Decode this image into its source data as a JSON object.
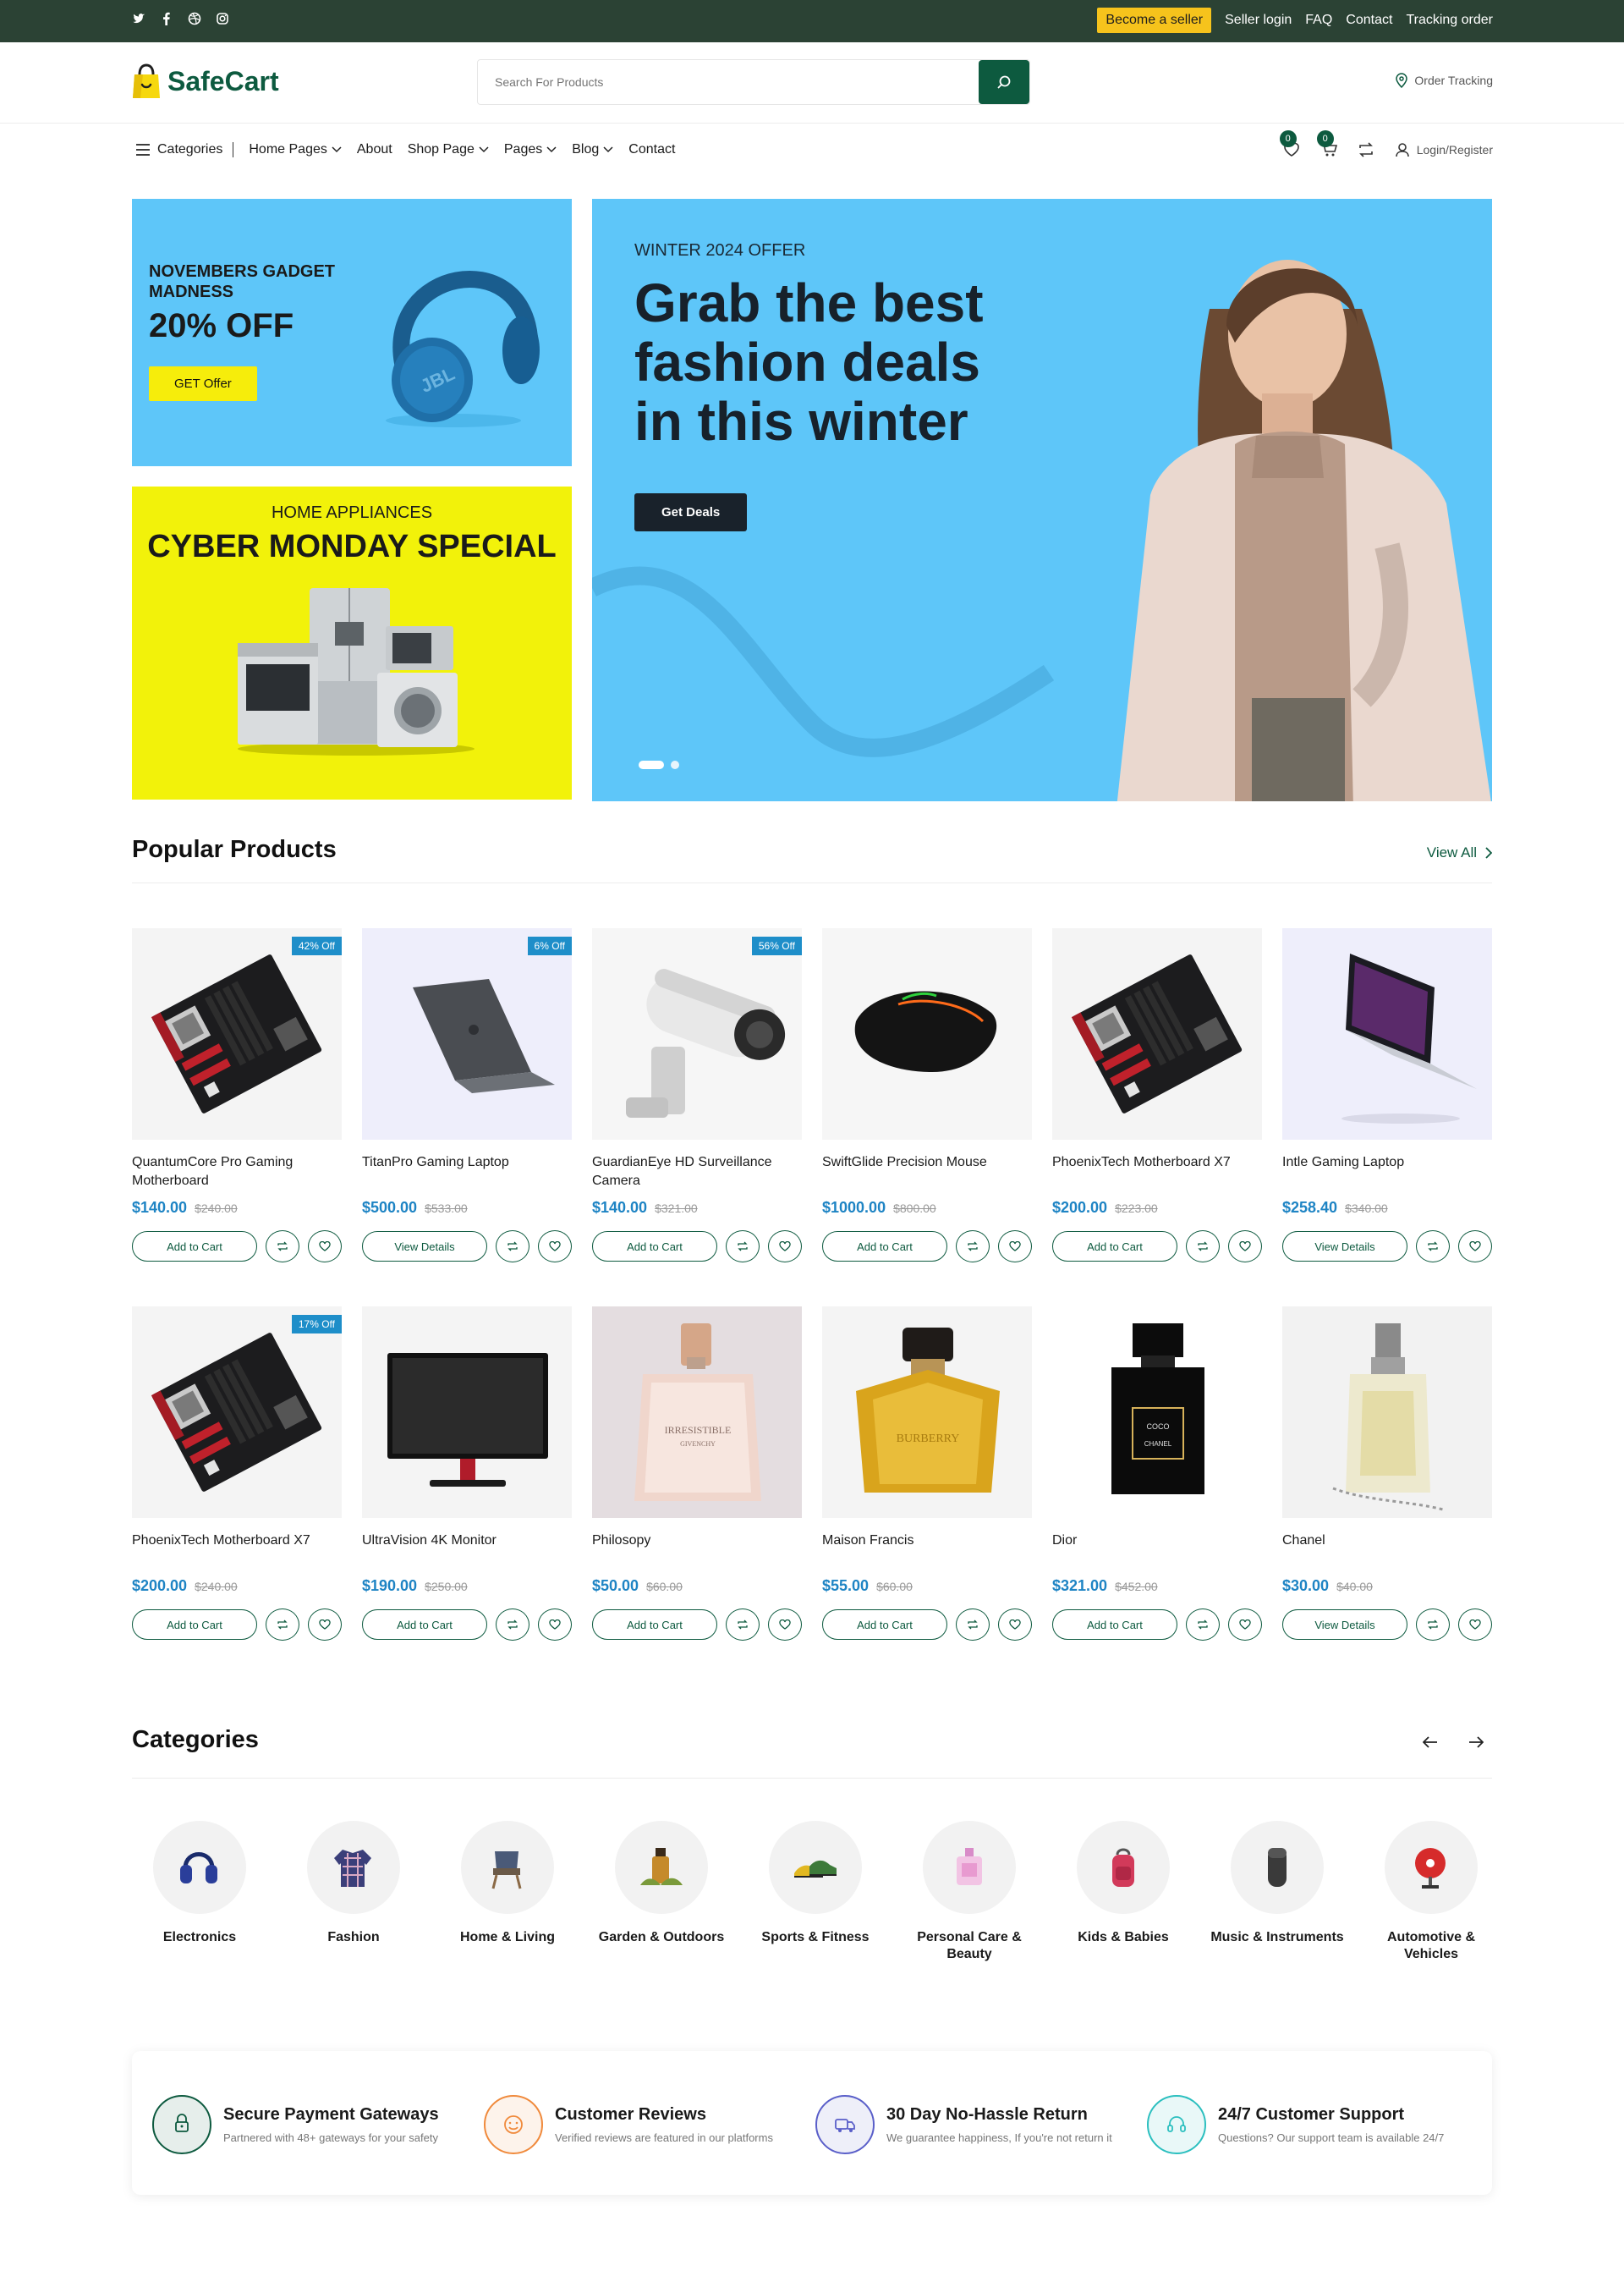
{
  "topbar": {
    "social_icons": [
      "twitter-icon",
      "facebook-icon",
      "dribbble-icon",
      "instagram-icon"
    ],
    "become_seller": "Become a seller",
    "links": [
      "Seller login",
      "FAQ",
      "Contact",
      "Tracking order"
    ]
  },
  "header": {
    "logo_text": "SafeCart",
    "search_placeholder": "Search For Products",
    "order_tracking": "Order Tracking"
  },
  "nav": {
    "categories": "Categories",
    "items": [
      "Home Pages",
      "About",
      "Shop Page",
      "Pages",
      "Blog",
      "Contact"
    ],
    "wishlist_count": "0",
    "cart_count": "0",
    "login": "Login/Register"
  },
  "banners": {
    "gadget": {
      "eyebrow": "NOVEMBERS GADGET MADNESS",
      "headline": "20% OFF",
      "button": "GET Offer"
    },
    "appliances": {
      "eyebrow": "HOME APPLIANCES",
      "headline": "CYBER MONDAY SPECIAL"
    },
    "hero": {
      "eyebrow": "WINTER 2024 OFFER",
      "headline_lines": [
        "Grab the best",
        "fashion deals",
        "in this winter"
      ],
      "button": "Get Deals"
    }
  },
  "popular": {
    "title": "Popular Products",
    "view_all": "View All",
    "products": [
      {
        "name": "QuantumCore Pro Gaming Motherboard",
        "price": "$140.00",
        "old": "$240.00",
        "badge": "42% Off",
        "button": "Add to Cart",
        "img": "motherboard"
      },
      {
        "name": "TitanPro Gaming Laptop",
        "price": "$500.00",
        "old": "$533.00",
        "badge": "6% Off",
        "button": "View Details",
        "img": "laptop-grey"
      },
      {
        "name": "GuardianEye HD Surveillance Camera",
        "price": "$140.00",
        "old": "$321.00",
        "badge": "56% Off",
        "button": "Add to Cart",
        "img": "camera"
      },
      {
        "name": "SwiftGlide Precision Mouse",
        "price": "$1000.00",
        "old": "$800.00",
        "badge": "",
        "button": "Add to Cart",
        "img": "mouse"
      },
      {
        "name": "PhoenixTech Motherboard X7",
        "price": "$200.00",
        "old": "$223.00",
        "badge": "",
        "button": "Add to Cart",
        "img": "motherboard"
      },
      {
        "name": "Intle Gaming Laptop",
        "price": "$258.40",
        "old": "$340.00",
        "badge": "",
        "button": "View Details",
        "img": "laptop-open"
      },
      {
        "name": "PhoenixTech Motherboard X7",
        "price": "$200.00",
        "old": "$240.00",
        "badge": "17% Off",
        "button": "Add to Cart",
        "img": "motherboard"
      },
      {
        "name": "UltraVision 4K Monitor",
        "price": "$190.00",
        "old": "$250.00",
        "badge": "",
        "button": "Add to Cart",
        "img": "monitor"
      },
      {
        "name": "Philosopy",
        "price": "$50.00",
        "old": "$60.00",
        "badge": "",
        "button": "Add to Cart",
        "img": "perfume-pink"
      },
      {
        "name": "Maison Francis",
        "price": "$55.00",
        "old": "$60.00",
        "badge": "",
        "button": "Add to Cart",
        "img": "perfume-gold"
      },
      {
        "name": "Dior",
        "price": "$321.00",
        "old": "$452.00",
        "badge": "",
        "button": "Add to Cart",
        "img": "perfume-black"
      },
      {
        "name": "Chanel",
        "price": "$30.00",
        "old": "$40.00",
        "badge": "",
        "button": "View Details",
        "img": "perfume-clear"
      }
    ]
  },
  "categories": {
    "title": "Categories",
    "items": [
      {
        "name": "Electronics",
        "icon": "headphones-icon"
      },
      {
        "name": "Fashion",
        "icon": "shirt-icon"
      },
      {
        "name": "Home & Living",
        "icon": "chair-icon"
      },
      {
        "name": "Garden & Outdoors",
        "icon": "plant-bottle-icon"
      },
      {
        "name": "Sports & Fitness",
        "icon": "sneakers-icon"
      },
      {
        "name": "Personal Care & Beauty",
        "icon": "perfume-icon"
      },
      {
        "name": "Kids & Babies",
        "icon": "backpack-icon"
      },
      {
        "name": "Music & Instruments",
        "icon": "speaker-icon"
      },
      {
        "name": "Automotive & Vehicles",
        "icon": "fan-icon"
      }
    ]
  },
  "features": [
    {
      "title": "Secure Payment Gateways",
      "sub": "Partnered with 48+ gateways for your safety",
      "color": "#0d5a3f",
      "icon": "lock-icon"
    },
    {
      "title": "Customer Reviews",
      "sub": "Verified reviews are featured in our platforms",
      "color": "#f08a3c",
      "icon": "smile-icon"
    },
    {
      "title": "30 Day No-Hassle Return",
      "sub": "We guarantee happiness, If you're not return it",
      "color": "#5a5fc9",
      "icon": "truck-icon"
    },
    {
      "title": "24/7 Customer Support",
      "sub": "Questions? Our support team is available 24/7",
      "color": "#2bbfbf",
      "icon": "headset-icon"
    }
  ],
  "colors": {
    "brand": "#0d5a3f",
    "topbar": "#2b4234",
    "price": "#1e84c4",
    "sky": "#5ec6f9",
    "yellow": "#f2f20a"
  }
}
